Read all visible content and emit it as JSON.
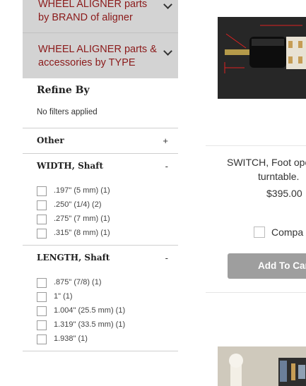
{
  "categories": [
    {
      "label": "WHEEL ALIGNER parts by BRAND of aligner"
    },
    {
      "label": "WHEEL ALIGNER parts & accessories by TYPE"
    }
  ],
  "refine": {
    "title": "Refine By",
    "no_filters": "No filters applied"
  },
  "facets": {
    "other": {
      "title": "Other",
      "toggle": "+"
    },
    "width": {
      "title": "WIDTH, Shaft",
      "toggle": "-",
      "options": [
        ".197\" (5 mm) (1)",
        ".250\" (1/4) (2)",
        ".275\" (7 mm) (1)",
        ".315\" (8 mm) (1)"
      ]
    },
    "length": {
      "title": "LENGTH, Shaft",
      "toggle": "-",
      "options": [
        ".875\" (7/8) (1)",
        "1\" (1)",
        "1.004\" (25.5 mm) (1)",
        "1.319\" (33.5 mm) (1)",
        "1.938\" (1)"
      ]
    }
  },
  "product": {
    "name_line1": "SWITCH, Foot ope",
    "name_line2": "turntable.",
    "price": "$395.00",
    "compare_label": "Compa",
    "add_button": "Add To Car"
  },
  "colors": {
    "category_text": "#8b1a1a",
    "category_bg": "#d3d3d3",
    "add_button_bg": "#9e9e9e"
  }
}
